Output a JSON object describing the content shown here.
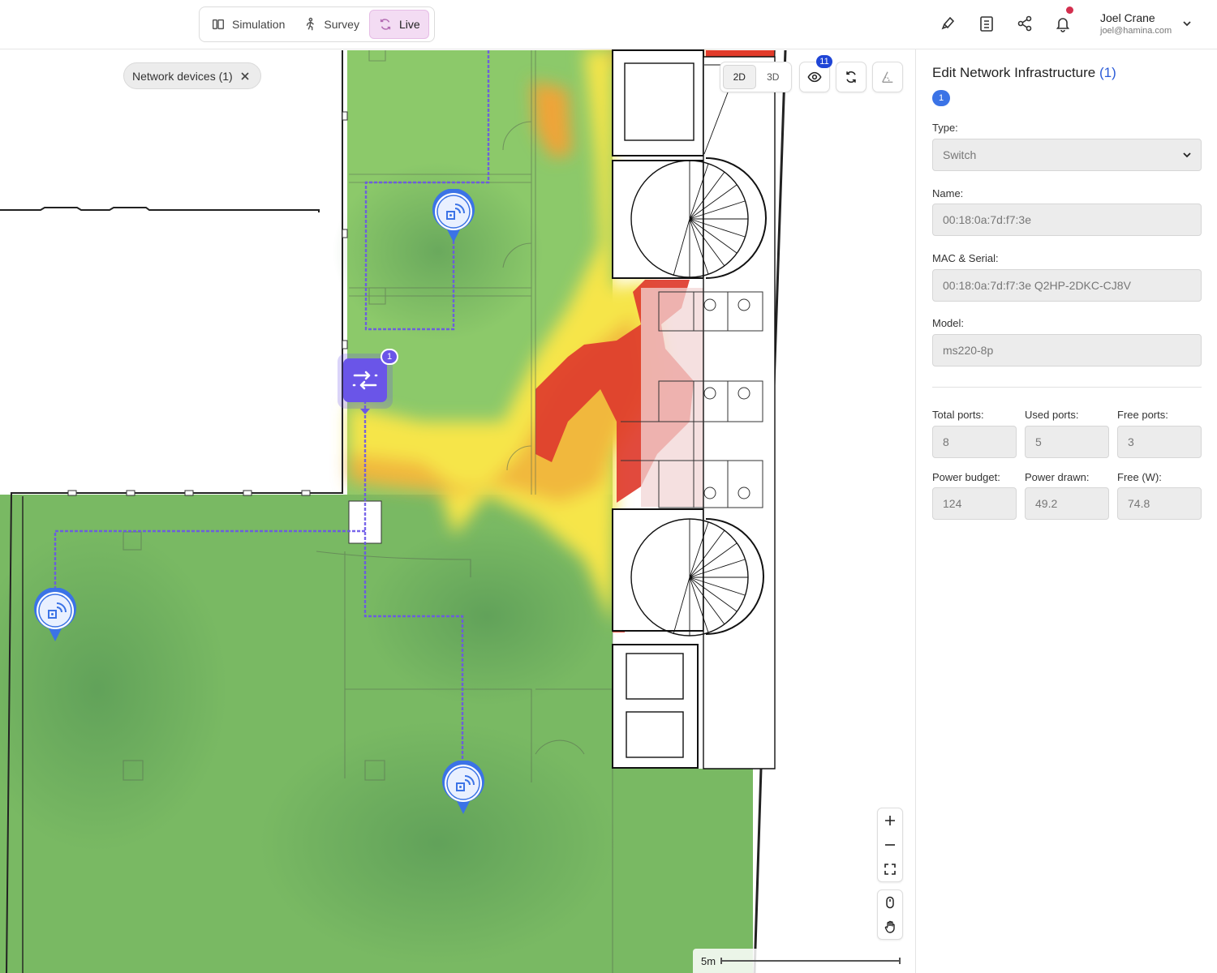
{
  "topbar": {
    "modes": [
      {
        "label": "Simulation",
        "icon": "simulation-icon",
        "active": false
      },
      {
        "label": "Survey",
        "icon": "walking-person-icon",
        "active": false
      },
      {
        "label": "Live",
        "icon": "refresh-icon",
        "active": true
      }
    ],
    "actions": [
      "brush-icon",
      "clipboard-icon",
      "share-icon",
      "bell-icon"
    ],
    "user": {
      "name": "Joel Crane",
      "email": "joel@hamina.com"
    }
  },
  "map": {
    "filter_chip": "Network devices (1)",
    "view_modes": [
      "2D",
      "3D"
    ],
    "active_view": "2D",
    "visibility_badge": "11",
    "switch_badge": "1",
    "scale_label": "5m"
  },
  "panel": {
    "title": "Edit Network Infrastructure",
    "title_count": "(1)",
    "selected_count": "1",
    "type_label": "Type:",
    "type_value": "Switch",
    "name_label": "Name:",
    "name_value": "00:18:0a:7d:f7:3e",
    "mac_label": "MAC & Serial:",
    "mac_value": "00:18:0a:7d:f7:3e Q2HP-2DKC-CJ8V",
    "model_label": "Model:",
    "model_value": "ms220-8p",
    "total_ports_label": "Total ports:",
    "total_ports": "8",
    "used_ports_label": "Used ports:",
    "used_ports": "5",
    "free_ports_label": "Free ports:",
    "free_ports": "3",
    "power_budget_label": "Power budget:",
    "power_budget": "124",
    "power_drawn_label": "Power drawn:",
    "power_drawn": "49.2",
    "free_w_label": "Free (W):",
    "free_w": "74.8"
  },
  "colors": {
    "accent_purple": "#6a55e8",
    "ap_blue": "#3b73e6",
    "heat_strong": "#3fa35a",
    "heat_weak": "#e23b2a"
  }
}
